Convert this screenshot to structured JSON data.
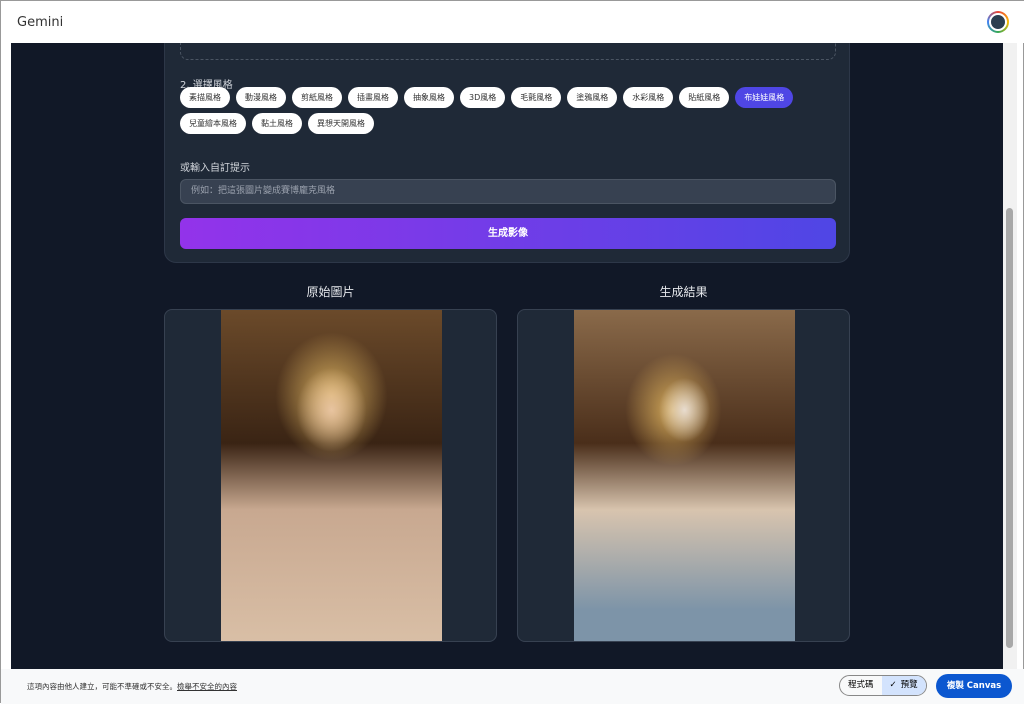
{
  "app": {
    "title": "Gemini"
  },
  "section2": {
    "label": "2. 選擇風格"
  },
  "styles": [
    "素描風格",
    "動漫風格",
    "剪紙風格",
    "插畫風格",
    "抽象風格",
    "3D風格",
    "毛氈風格",
    "塗鴉風格",
    "水彩風格",
    "貼紙風格",
    "布娃娃風格",
    "兒童繪本風格",
    "黏土風格",
    "異想天開風格"
  ],
  "selected_style": "布娃娃風格",
  "custom": {
    "label": "或輸入自訂提示",
    "placeholder": "例如：把這張圖片變成賽博龐克風格"
  },
  "generate_label": "生成影像",
  "original_label": "原始圖片",
  "result_label": "生成結果",
  "footer": {
    "notice": "這項內容由他人建立，可能不準確或不安全。",
    "report_link": "檢舉不安全的內容",
    "code": "程式碼",
    "preview": "預覽",
    "copy": "複製 Canvas"
  }
}
